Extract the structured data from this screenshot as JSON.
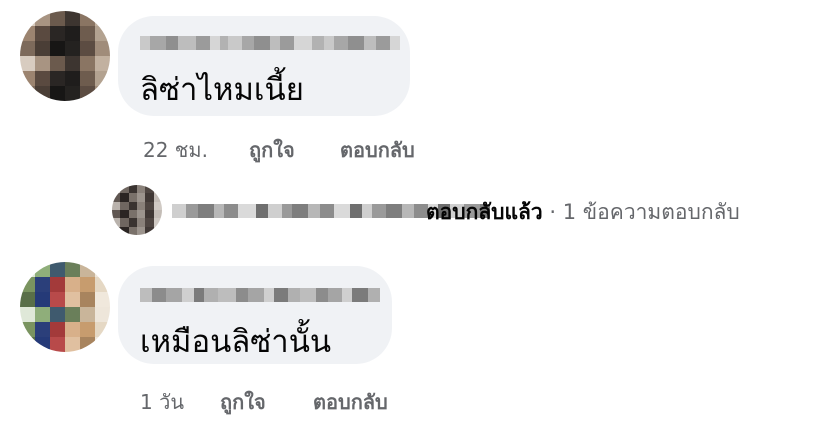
{
  "comments": [
    {
      "text": "ลิซ่าไหมเนี้ย",
      "time": "22 ชม.",
      "like_label": "ถูกใจ",
      "reply_label": "ตอบกลับ",
      "reply_summary": {
        "replied_label": "ตอบกลับแล้ว",
        "separator": "·",
        "count_label": "1 ข้อความตอบกลับ"
      }
    },
    {
      "text": "เหมือนลิซ่านั้น",
      "time": "1 วัน",
      "like_label": "ถูกใจ",
      "reply_label": "ตอบกลับ"
    }
  ],
  "colors": {
    "bubble": "#f0f2f5",
    "text": "#050505",
    "secondary": "#65676b"
  }
}
